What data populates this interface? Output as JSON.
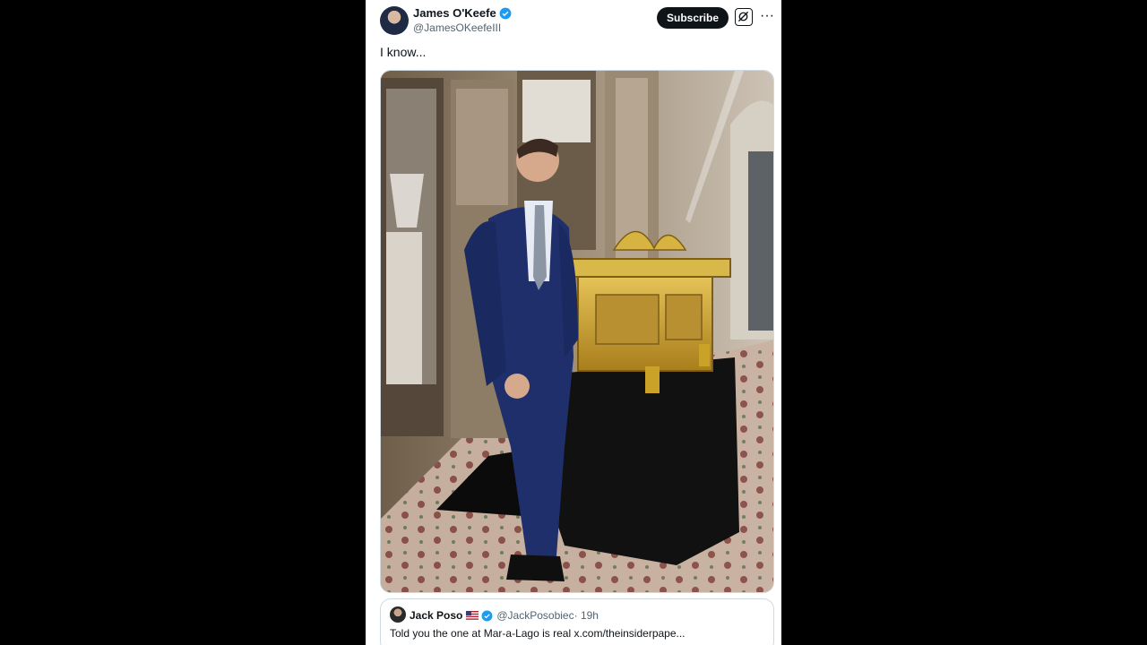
{
  "post": {
    "author_name": "James O'Keefe",
    "author_handle": "@JamesOKeefeIII",
    "text": "I know...",
    "subscribe_label": "Subscribe",
    "more_label": "···"
  },
  "quote": {
    "author_name": "Jack Poso",
    "author_handle": "@JackPosobiec",
    "time": "· 19h",
    "text": "Told you the one at Mar-a-Lago is real x.com/theinsiderpape..."
  },
  "colors": {
    "accent": "#1d9bf0",
    "text": "#0f1419",
    "muted": "#536471",
    "gold": "#c9a227",
    "suit": "#1e2f6b"
  },
  "icons": [
    "verified-badge-icon",
    "grok-icon",
    "more-icon",
    "us-flag-icon"
  ]
}
